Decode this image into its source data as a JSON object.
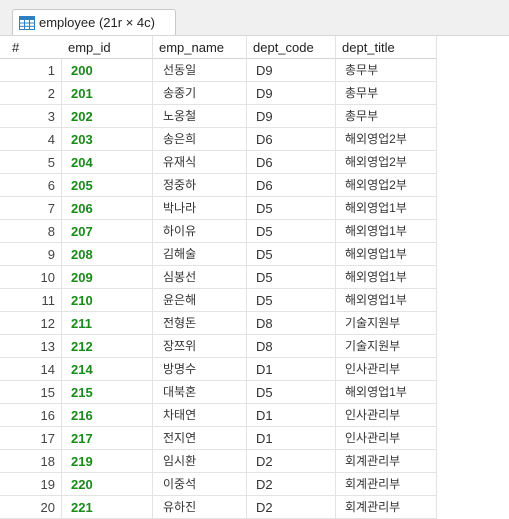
{
  "tab": {
    "label": "employee (21r × 4c)",
    "icon": "table-icon"
  },
  "columns": [
    "#",
    "emp_id",
    "emp_name",
    "dept_code",
    "dept_title"
  ],
  "primary_key_icon": "key-icon",
  "rows": [
    [
      "1",
      "200",
      "선동일",
      "D9",
      "총무부"
    ],
    [
      "2",
      "201",
      "송종기",
      "D9",
      "총무부"
    ],
    [
      "3",
      "202",
      "노옹철",
      "D9",
      "총무부"
    ],
    [
      "4",
      "203",
      "송은희",
      "D6",
      "해외영업2부"
    ],
    [
      "5",
      "204",
      "유재식",
      "D6",
      "해외영업2부"
    ],
    [
      "6",
      "205",
      "정중하",
      "D6",
      "해외영업2부"
    ],
    [
      "7",
      "206",
      "박나라",
      "D5",
      "해외영업1부"
    ],
    [
      "8",
      "207",
      "하이유",
      "D5",
      "해외영업1부"
    ],
    [
      "9",
      "208",
      "김해술",
      "D5",
      "해외영업1부"
    ],
    [
      "10",
      "209",
      "심봉선",
      "D5",
      "해외영업1부"
    ],
    [
      "11",
      "210",
      "윤은해",
      "D5",
      "해외영업1부"
    ],
    [
      "12",
      "211",
      "전형돈",
      "D8",
      "기술지원부"
    ],
    [
      "13",
      "212",
      "장쯔위",
      "D8",
      "기술지원부"
    ],
    [
      "14",
      "214",
      "방명수",
      "D1",
      "인사관리부"
    ],
    [
      "15",
      "215",
      "대북혼",
      "D5",
      "해외영업1부"
    ],
    [
      "16",
      "216",
      "차태연",
      "D1",
      "인사관리부"
    ],
    [
      "17",
      "217",
      "전지연",
      "D1",
      "인사관리부"
    ],
    [
      "18",
      "219",
      "임시환",
      "D2",
      "회계관리부"
    ],
    [
      "19",
      "220",
      "이중석",
      "D2",
      "회계관리부"
    ],
    [
      "20",
      "221",
      "유하진",
      "D2",
      "회계관리부"
    ]
  ],
  "colors": {
    "emp_id_text": "#1a8a1a",
    "grid_line": "#e3e3e3"
  }
}
